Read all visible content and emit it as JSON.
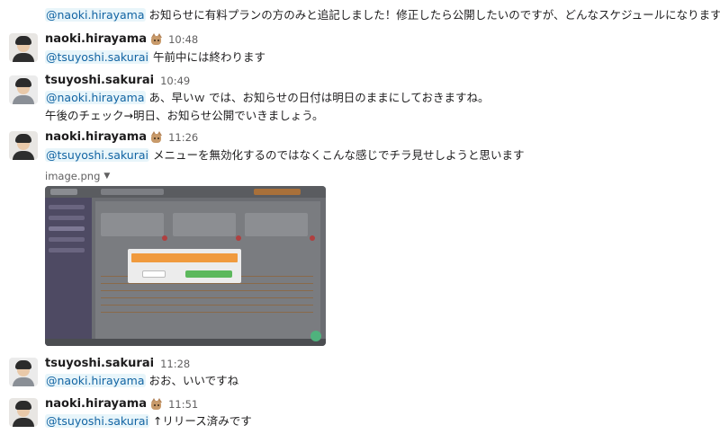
{
  "messages": [
    {
      "text_parts": [
        {
          "mention": "@naoki.hirayama"
        },
        {
          "text": " お知らせに有料プランの方のみと追記しました！修正したら公開したいのですが、どんなスケジュールになりますか？"
        }
      ]
    },
    {
      "author": "naoki.hirayama",
      "time": "10:48",
      "mention": "@tsuyoshi.sakurai",
      "text": " 午前中には終わります"
    },
    {
      "author": "tsuyoshi.sakurai",
      "time": "10:49",
      "mention": "@naoki.hirayama",
      "text": " あ、早いｗ では、お知らせの日付は明日のままにしておきますね。",
      "text_line2": "午後のチェック→明日、お知らせ公開でいきましょう。"
    },
    {
      "author": "naoki.hirayama",
      "time": "11:26",
      "mention": "@tsuyoshi.sakurai",
      "text": " メニューを無効化するのではなくこんな感じでチラ見せしようと思います",
      "file_name": "image.png"
    },
    {
      "author": "tsuyoshi.sakurai",
      "time": "11:28",
      "mention": "@naoki.hirayama",
      "text": " おお、いいですね"
    },
    {
      "author": "naoki.hirayama",
      "time": "11:51",
      "mention": "@tsuyoshi.sakurai",
      "text": " ↑リリース済みです"
    }
  ],
  "colors": {
    "mention_text": "#1264a3",
    "mention_bg": "#e8f5fa",
    "timestamp": "#616061"
  }
}
